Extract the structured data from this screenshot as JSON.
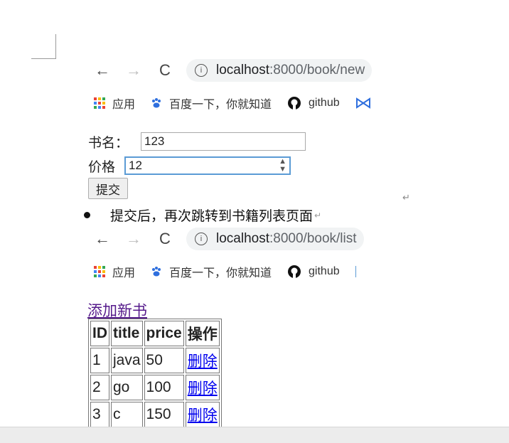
{
  "top_browser": {
    "url_host": "localhost",
    "url_path": ":8000/book/new",
    "back_icon": "arrow-left",
    "forward_icon": "arrow-right",
    "reload_icon": "reload"
  },
  "bookmarks_top": [
    {
      "icon": "apps-grid-icon",
      "label": "应用"
    },
    {
      "icon": "baidu-paw-icon",
      "label": "百度一下，你就知道"
    },
    {
      "icon": "github-icon",
      "label": "github"
    }
  ],
  "form": {
    "title_label": "书名：",
    "title_value": "123",
    "price_label": "价格",
    "price_value": "12",
    "submit_label": "提交"
  },
  "note": {
    "text": "提交后，再次跳转到书籍列表页面"
  },
  "bottom_browser": {
    "url_host": "localhost",
    "url_path": ":8000/book/list"
  },
  "bookmarks_bottom": [
    {
      "icon": "apps-grid-icon",
      "label": "应用"
    },
    {
      "icon": "baidu-paw-icon",
      "label": "百度一下，你就知道"
    },
    {
      "icon": "github-icon",
      "label": "github"
    }
  ],
  "list_page": {
    "add_link": "添加新书",
    "headers": [
      "ID",
      "title",
      "price",
      "操作"
    ],
    "rows": [
      [
        "1",
        "java",
        "50",
        "删除"
      ],
      [
        "2",
        "go",
        "100",
        "删除"
      ],
      [
        "3",
        "c",
        "150",
        "删除"
      ]
    ]
  },
  "colors": {
    "link_visited": "#551a8b",
    "link": "#0000ee",
    "address_bg": "#f1f3f4",
    "input_focus": "#5b9bd5"
  }
}
